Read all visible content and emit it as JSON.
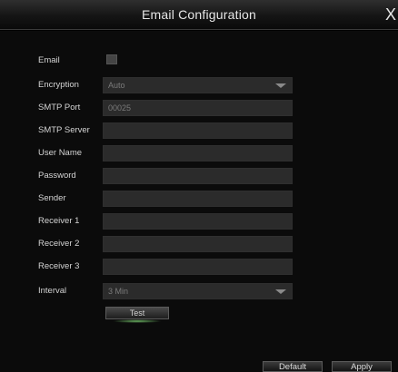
{
  "window": {
    "title": "Email Configuration",
    "close_glyph": "X"
  },
  "form": {
    "email": {
      "label": "Email",
      "checked": false
    },
    "encryption": {
      "label": "Encryption",
      "value": "Auto"
    },
    "smtp_port": {
      "label": "SMTP Port",
      "value": "00025"
    },
    "smtp_server": {
      "label": "SMTP Server",
      "value": ""
    },
    "user_name": {
      "label": "User Name",
      "value": ""
    },
    "password": {
      "label": "Password",
      "value": ""
    },
    "sender": {
      "label": "Sender",
      "value": ""
    },
    "receiver_1": {
      "label": "Receiver 1",
      "value": ""
    },
    "receiver_2": {
      "label": "Receiver 2",
      "value": ""
    },
    "receiver_3": {
      "label": "Receiver 3",
      "value": ""
    },
    "interval": {
      "label": "Interval",
      "value": "3 Min"
    }
  },
  "buttons": {
    "test": "Test",
    "default": "Default",
    "apply": "Apply"
  },
  "colors": {
    "background": "#0b0b0b",
    "field": "#2b2b2b",
    "text": "#d4d4d4",
    "test_glow": "#78c86e"
  }
}
